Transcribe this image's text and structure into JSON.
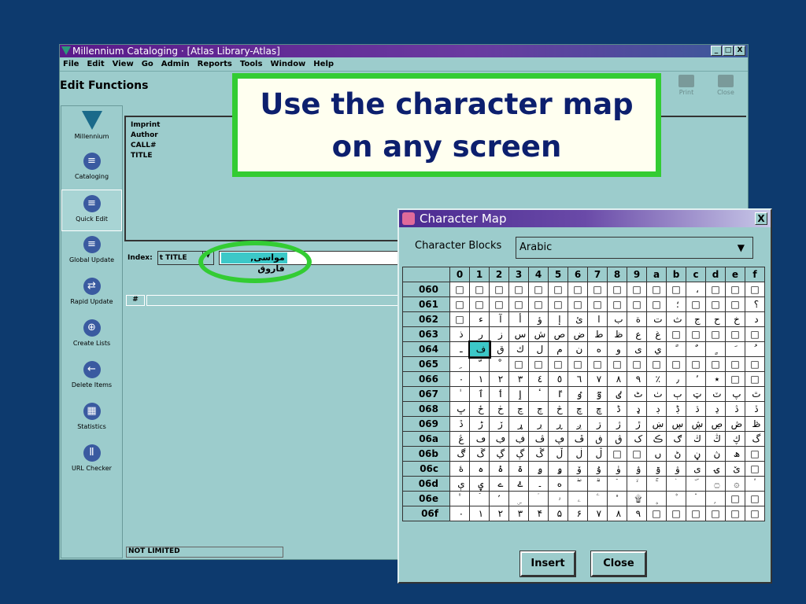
{
  "window": {
    "title": "Millennium Cataloging · [Atlas Library-Atlas]",
    "controls": [
      "_",
      "□",
      "X"
    ]
  },
  "menu": [
    "File",
    "Edit",
    "View",
    "Go",
    "Admin",
    "Reports",
    "Tools",
    "Window",
    "Help"
  ],
  "toolbar": {
    "heading": "Edit Functions",
    "print": "Print",
    "close": "Close"
  },
  "sidebar": [
    {
      "label": "Millennium",
      "icon": "millennium-logo-icon",
      "glyph": ""
    },
    {
      "label": "Cataloging",
      "icon": "cataloging-icon",
      "glyph": "≡"
    },
    {
      "label": "Quick Edit",
      "icon": "quick-edit-icon",
      "glyph": "≡"
    },
    {
      "label": "Global Update",
      "icon": "global-update-icon",
      "glyph": "≡"
    },
    {
      "label": "Rapid Update",
      "icon": "rapid-update-icon",
      "glyph": "⇄"
    },
    {
      "label": "Create Lists",
      "icon": "create-lists-icon",
      "glyph": "⊕"
    },
    {
      "label": "Delete Items",
      "icon": "delete-items-icon",
      "glyph": "←"
    },
    {
      "label": "Statistics",
      "icon": "statistics-icon",
      "glyph": "▦"
    },
    {
      "label": "URL Checker",
      "icon": "url-checker-icon",
      "glyph": "Ⅱ"
    }
  ],
  "record_fields": [
    "Imprint",
    "Author",
    "CALL#",
    "TITLE"
  ],
  "index": {
    "label": "Index:",
    "selected": "t TITLE",
    "value": "مواسی, فاروق"
  },
  "list": {
    "col_hash": "#"
  },
  "status": "NOT LIMITED",
  "callout": {
    "line1": "Use the character map",
    "line2": "on any screen"
  },
  "charmap": {
    "title": "Character Map",
    "blocks_label": "Character Blocks",
    "block": "Arabic",
    "close_x": "X",
    "cols": [
      "0",
      "1",
      "2",
      "3",
      "4",
      "5",
      "6",
      "7",
      "8",
      "9",
      "a",
      "b",
      "c",
      "d",
      "e",
      "f"
    ],
    "rows": [
      {
        "label": "060",
        "chars": "□□□□□□□□□□□□،□□□"
      },
      {
        "label": "061",
        "chars": "□□□□□□□□□□□؛□□□؟"
      },
      {
        "label": "062",
        "chars": "□ءآأؤإئابةتثجحخد"
      },
      {
        "label": "063",
        "chars": "ذرزسشصضطظعغ□□□□□"
      },
      {
        "label": "064",
        "chars": "ـفقكلمنهوىيًٌٍَُ"
      },
      {
        "label": "065",
        "chars": "ِّْ□□□□□□□□□□□□□"
      },
      {
        "label": "066",
        "chars": "٠١٢٣٤٥٦٧٨٩٪٫٬٭□□"
      },
      {
        "label": "067",
        "chars": "ٰٱٲٳٴٵٶٷٸٹٺٻټٽپٿ"
      },
      {
        "label": "068",
        "chars": "ڀځڂڃڄڅچڇڈډڊڋڌڍڎڏ"
      },
      {
        "label": "069",
        "chars": "ڐڑڒړڔڕږڗژڙښڛڜڝڞڟ"
      },
      {
        "label": "06a",
        "chars": "ڠڡڢڣڤڥڦڧڨکڪګڬڭڮگ"
      },
      {
        "label": "06b",
        "chars": "ڰڱڲڳڴڵڶڷ□□ںڻڼڽھ□"
      },
      {
        "label": "06c",
        "chars": "ۀہۂۃۄۅۆۇۈۉۊۋیۍێ□"
      },
      {
        "label": "06d",
        "chars": "ېۑےۓ۔ەۖۗۘۙۚۛۜ۝۞۟"
      },
      {
        "label": "06e",
        "chars": "ۣ۠ۡۢۤۥۦۧۨ۩۪ۭ۫۬□□"
      },
      {
        "label": "06f",
        "chars": "۰۱۲۳۴۵۶۷۸۹□□□□□□"
      }
    ],
    "selected": {
      "row": "064",
      "col": "1"
    },
    "insert": "Insert",
    "close": "Close"
  }
}
